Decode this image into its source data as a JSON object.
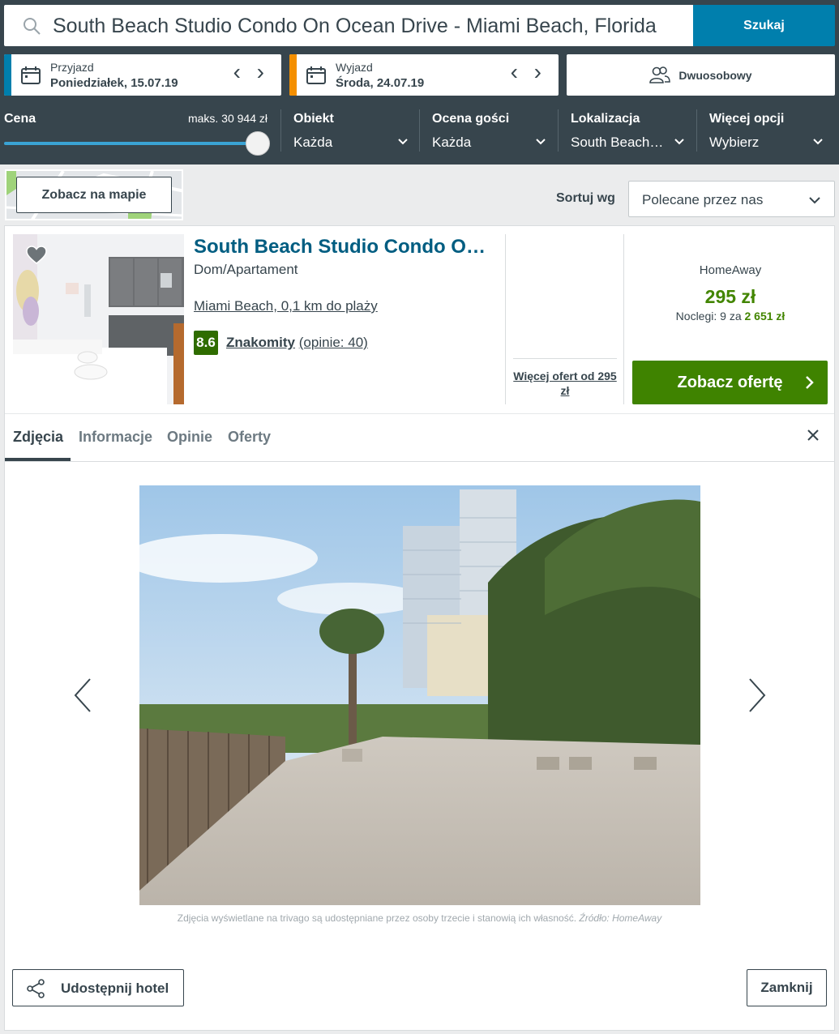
{
  "search": {
    "query": "South Beach Studio Condo On Ocean Drive - Miami Beach, Florida",
    "button_label": "Szukaj"
  },
  "dates": {
    "checkin_label": "Przyjazd",
    "checkin_value": "Poniedziałek, 15.07.19",
    "checkout_label": "Wyjazd",
    "checkout_value": "Środa, 24.07.19",
    "prev_next": "<>"
  },
  "guests": {
    "label": "Dwuosobowy"
  },
  "filters": {
    "price_label": "Cena",
    "price_max": "maks. 30 944 zł",
    "price_slider_level": 1.0,
    "items": [
      {
        "title": "Obiekt",
        "value": "Każda"
      },
      {
        "title": "Ocena gości",
        "value": "Każda"
      },
      {
        "title": "Lokalizacja",
        "value": "South Beach…"
      },
      {
        "title": "Więcej opcji",
        "value": "Wybierz"
      }
    ]
  },
  "map": {
    "button_label": "Zobacz na mapie"
  },
  "sort": {
    "label": "Sortuj wg",
    "value": "Polecane przez nas"
  },
  "hotel": {
    "name": "South Beach Studio Condo On Ocean Drive",
    "type": "Dom/Apartament",
    "location": "Miami Beach, 0,1 km do plaży",
    "rating_score": "8.6",
    "rating_label": "Znakomity",
    "rating_count": "(opinie: 40)",
    "more_offers": "Więcej ofert od 295 zł",
    "provider": "HomeAway",
    "price": "295 zł",
    "nights_prefix": "Noclegi: 9 za ",
    "nights_total": "2 651 zł",
    "cta_label": "Zobacz ofertę"
  },
  "tabs": [
    {
      "label": "Zdjęcia",
      "active": true
    },
    {
      "label": "Informacje",
      "active": false
    },
    {
      "label": "Opinie",
      "active": false
    },
    {
      "label": "Oferty",
      "active": false
    }
  ],
  "gallery": {
    "caption": "Zdjęcia wyświetlane na trivago są udostępniane przez osoby trzecie i stanowią ich własność.",
    "source": "Źródło: HomeAway"
  },
  "footer": {
    "share_label": "Udostępnij hotel",
    "close_label": "Zamknij"
  },
  "colors": {
    "header_bg": "#37454d",
    "search_button": "#007fad",
    "checkin_accent": "#007fad",
    "checkout_accent": "#f48f00",
    "price_green": "#428500",
    "cta_green": "#3f8300",
    "rating_green": "#2f6c00",
    "hotel_link": "#005d81"
  },
  "icons": [
    "search-icon",
    "calendar-icon",
    "people-icon",
    "chevron-down-icon",
    "heart-icon",
    "chevron-right-icon",
    "close-icon",
    "share-icon",
    "arrow-left-icon",
    "arrow-right-icon"
  ]
}
